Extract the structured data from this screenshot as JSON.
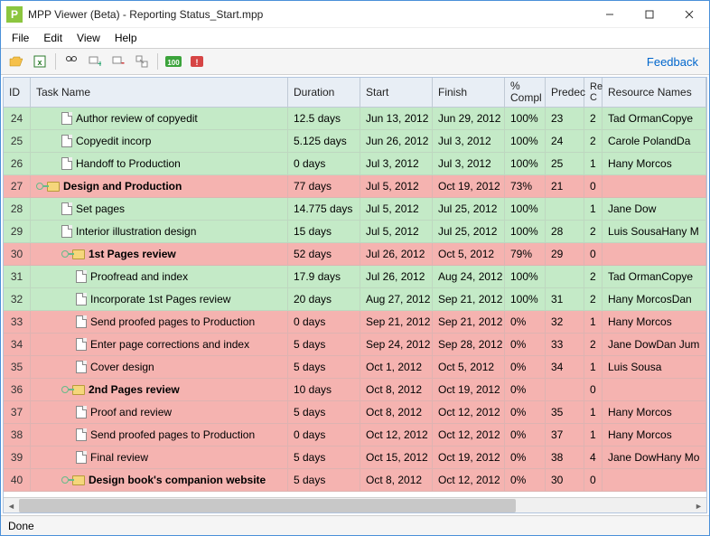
{
  "window": {
    "title": "MPP Viewer (Beta) - Reporting Status_Start.mpp",
    "app_letter": "P"
  },
  "menu": {
    "file": "File",
    "edit": "Edit",
    "view": "View",
    "help": "Help"
  },
  "toolbar": {
    "feedback": "Feedback"
  },
  "status": "Done",
  "columns": {
    "id": "ID",
    "name": "Task Name",
    "duration": "Duration",
    "start": "Start",
    "finish": "Finish",
    "complete": "% Compl",
    "pred": "Predec",
    "rc": "Re C",
    "res": "Resource Names"
  },
  "rows": [
    {
      "id": "24",
      "name": "Author review of copyedit",
      "dur": "12.5 days",
      "start": "Jun 13, 2012",
      "finish": "Jun 29, 2012",
      "comp": "100%",
      "pred": "23",
      "rc": "2",
      "res": "Tad OrmanCopye",
      "type": "task",
      "indent": 1,
      "color": "green"
    },
    {
      "id": "25",
      "name": "Copyedit incorp",
      "dur": "5.125 days",
      "start": "Jun 26, 2012",
      "finish": "Jul 3, 2012",
      "comp": "100%",
      "pred": "24",
      "rc": "2",
      "res": "Carole PolandDa",
      "type": "task",
      "indent": 1,
      "color": "green"
    },
    {
      "id": "26",
      "name": "Handoff to Production",
      "dur": "0 days",
      "start": "Jul 3, 2012",
      "finish": "Jul 3, 2012",
      "comp": "100%",
      "pred": "25",
      "rc": "1",
      "res": "Hany Morcos",
      "type": "task",
      "indent": 1,
      "color": "green"
    },
    {
      "id": "27",
      "name": "Design and Production",
      "dur": "77 days",
      "start": "Jul 5, 2012",
      "finish": "Oct 19, 2012",
      "comp": "73%",
      "pred": "21",
      "rc": "0",
      "res": "",
      "type": "summary",
      "indent": 0,
      "color": "pink",
      "key": true
    },
    {
      "id": "28",
      "name": "Set pages",
      "dur": "14.775 days",
      "start": "Jul 5, 2012",
      "finish": "Jul 25, 2012",
      "comp": "100%",
      "pred": "",
      "rc": "1",
      "res": "Jane Dow",
      "type": "task",
      "indent": 1,
      "color": "green"
    },
    {
      "id": "29",
      "name": "Interior illustration design",
      "dur": "15 days",
      "start": "Jul 5, 2012",
      "finish": "Jul 25, 2012",
      "comp": "100%",
      "pred": "28",
      "rc": "2",
      "res": "Luis SousaHany M",
      "type": "task",
      "indent": 1,
      "color": "green"
    },
    {
      "id": "30",
      "name": "1st Pages review",
      "dur": "52 days",
      "start": "Jul 26, 2012",
      "finish": "Oct 5, 2012",
      "comp": "79%",
      "pred": "29",
      "rc": "0",
      "res": "",
      "type": "summary",
      "indent": 1,
      "color": "pink",
      "key": true
    },
    {
      "id": "31",
      "name": "Proofread and index",
      "dur": "17.9 days",
      "start": "Jul 26, 2012",
      "finish": "Aug 24, 2012",
      "comp": "100%",
      "pred": "",
      "rc": "2",
      "res": "Tad OrmanCopye",
      "type": "task",
      "indent": 2,
      "color": "green"
    },
    {
      "id": "32",
      "name": "Incorporate 1st Pages review",
      "dur": "20 days",
      "start": "Aug 27, 2012",
      "finish": "Sep 21, 2012",
      "comp": "100%",
      "pred": "31",
      "rc": "2",
      "res": "Hany MorcosDan",
      "type": "task",
      "indent": 2,
      "color": "green"
    },
    {
      "id": "33",
      "name": "Send proofed pages to Production",
      "dur": "0 days",
      "start": "Sep 21, 2012",
      "finish": "Sep 21, 2012",
      "comp": "0%",
      "pred": "32",
      "rc": "1",
      "res": "Hany Morcos",
      "type": "task",
      "indent": 2,
      "color": "pink"
    },
    {
      "id": "34",
      "name": "Enter page corrections and index",
      "dur": "5 days",
      "start": "Sep 24, 2012",
      "finish": "Sep 28, 2012",
      "comp": "0%",
      "pred": "33",
      "rc": "2",
      "res": "Jane DowDan Jum",
      "type": "task",
      "indent": 2,
      "color": "pink"
    },
    {
      "id": "35",
      "name": "Cover design",
      "dur": "5 days",
      "start": "Oct 1, 2012",
      "finish": "Oct 5, 2012",
      "comp": "0%",
      "pred": "34",
      "rc": "1",
      "res": "Luis Sousa",
      "type": "task",
      "indent": 2,
      "color": "pink"
    },
    {
      "id": "36",
      "name": "2nd Pages review",
      "dur": "10 days",
      "start": "Oct 8, 2012",
      "finish": "Oct 19, 2012",
      "comp": "0%",
      "pred": "",
      "rc": "0",
      "res": "",
      "type": "summary",
      "indent": 1,
      "color": "pink",
      "key": true
    },
    {
      "id": "37",
      "name": "Proof and review",
      "dur": "5 days",
      "start": "Oct 8, 2012",
      "finish": "Oct 12, 2012",
      "comp": "0%",
      "pred": "35",
      "rc": "1",
      "res": "Hany Morcos",
      "type": "task",
      "indent": 2,
      "color": "pink"
    },
    {
      "id": "38",
      "name": "Send proofed pages to Production",
      "dur": "0 days",
      "start": "Oct 12, 2012",
      "finish": "Oct 12, 2012",
      "comp": "0%",
      "pred": "37",
      "rc": "1",
      "res": "Hany Morcos",
      "type": "task",
      "indent": 2,
      "color": "pink"
    },
    {
      "id": "39",
      "name": "Final review",
      "dur": "5 days",
      "start": "Oct 15, 2012",
      "finish": "Oct 19, 2012",
      "comp": "0%",
      "pred": "38",
      "rc": "4",
      "res": "Jane DowHany Mo",
      "type": "task",
      "indent": 2,
      "color": "pink"
    },
    {
      "id": "40",
      "name": "Design book's companion website",
      "dur": "5 days",
      "start": "Oct 8, 2012",
      "finish": "Oct 12, 2012",
      "comp": "0%",
      "pred": "30",
      "rc": "0",
      "res": "",
      "type": "summary",
      "indent": 1,
      "color": "pink",
      "key": true
    }
  ]
}
